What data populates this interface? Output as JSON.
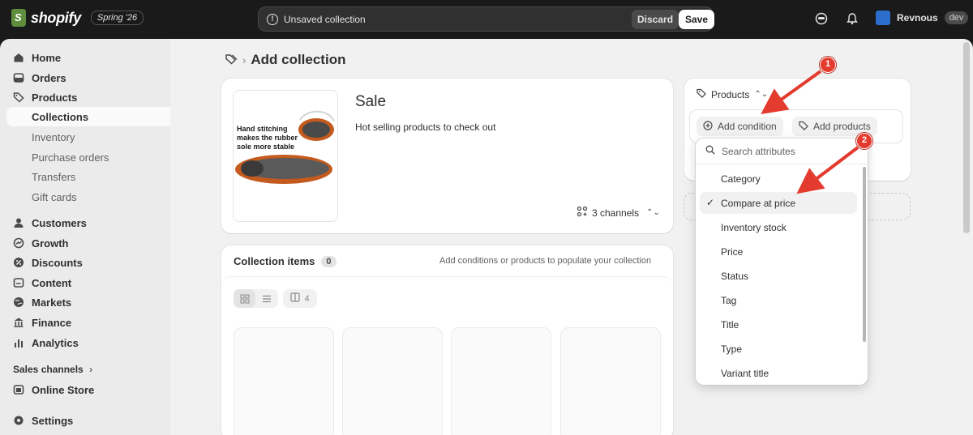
{
  "topbar": {
    "brand": "shopify",
    "edition": "Spring '26",
    "unsaved_message": "Unsaved collection",
    "discard_label": "Discard",
    "save_label": "Save",
    "icons": [
      "store-icon",
      "bell-icon"
    ],
    "user_name": "Revnous",
    "user_badge": "dev"
  },
  "sidebar": {
    "items": [
      {
        "label": "Home",
        "icon": "home-icon"
      },
      {
        "label": "Orders",
        "icon": "orders-icon"
      },
      {
        "label": "Products",
        "icon": "tag-icon"
      },
      {
        "label": "Collections",
        "active": true
      },
      {
        "label": "Inventory"
      },
      {
        "label": "Purchase orders"
      },
      {
        "label": "Transfers"
      },
      {
        "label": "Gift cards"
      },
      {
        "label": "Customers",
        "icon": "person-icon"
      },
      {
        "label": "Growth",
        "icon": "growth-icon"
      },
      {
        "label": "Discounts",
        "icon": "discount-icon"
      },
      {
        "label": "Content",
        "icon": "content-icon"
      },
      {
        "label": "Markets",
        "icon": "globe-icon"
      },
      {
        "label": "Finance",
        "icon": "bank-icon"
      },
      {
        "label": "Analytics",
        "icon": "chart-icon"
      }
    ],
    "sales_channels_label": "Sales channels",
    "online_store_label": "Online Store",
    "settings_label": "Settings"
  },
  "page": {
    "title": "Add collection",
    "collection_title": "Sale",
    "collection_description": "Hot selling products to check out",
    "image_caption": "Hand stitching makes the rubber sole more stable",
    "channels_label": "3 channels",
    "items_title": "Collection items",
    "items_count": "0",
    "items_hint": "Add conditions or products to populate your collection",
    "column_count": "4"
  },
  "conditions": {
    "products_label": "Products",
    "add_condition_label": "Add condition",
    "add_products_label": "Add products"
  },
  "dropdown": {
    "search_placeholder": "Search attributes",
    "options": [
      "Category",
      "Compare at price",
      "Inventory stock",
      "Price",
      "Status",
      "Tag",
      "Title",
      "Type",
      "Variant title"
    ],
    "selected": "Compare at price"
  },
  "annotations": {
    "markers": [
      "1",
      "2"
    ],
    "color": "#e33b2e"
  },
  "colors": {
    "topbar": "#1a1a1a",
    "sidebar": "#ebebeb",
    "main": "#f1f1f1",
    "brand_green": "#5e8e3e"
  }
}
